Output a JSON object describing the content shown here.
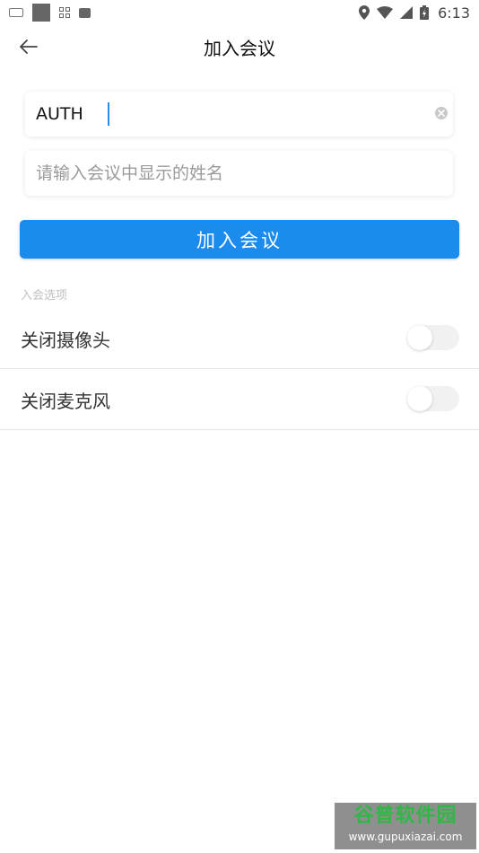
{
  "status_bar": {
    "time": "6:13",
    "icons": [
      "keyboard-icon",
      "square-icon",
      "grid-icon",
      "message-icon",
      "location-icon",
      "wifi-icon",
      "signal-icon",
      "battery-icon"
    ]
  },
  "header": {
    "title": "加入会议",
    "back_icon": "arrow-left-icon"
  },
  "form": {
    "meeting_id_value": "AUTH",
    "name_placeholder": "请输入会议中显示的姓名"
  },
  "join_button_label": "加入会议",
  "options": {
    "section_title": "入会选项",
    "items": [
      {
        "label": "关闭摄像头",
        "enabled": false
      },
      {
        "label": "关闭麦克风",
        "enabled": false
      }
    ]
  },
  "watermark": {
    "logo_text": "谷普软件园",
    "url": "www.gupuxiazai.com"
  },
  "colors": {
    "accent": "#1b8cee",
    "caret": "#2a8ee8",
    "watermark_bg": "#8f8f8f",
    "watermark_green": "#2fb845"
  }
}
